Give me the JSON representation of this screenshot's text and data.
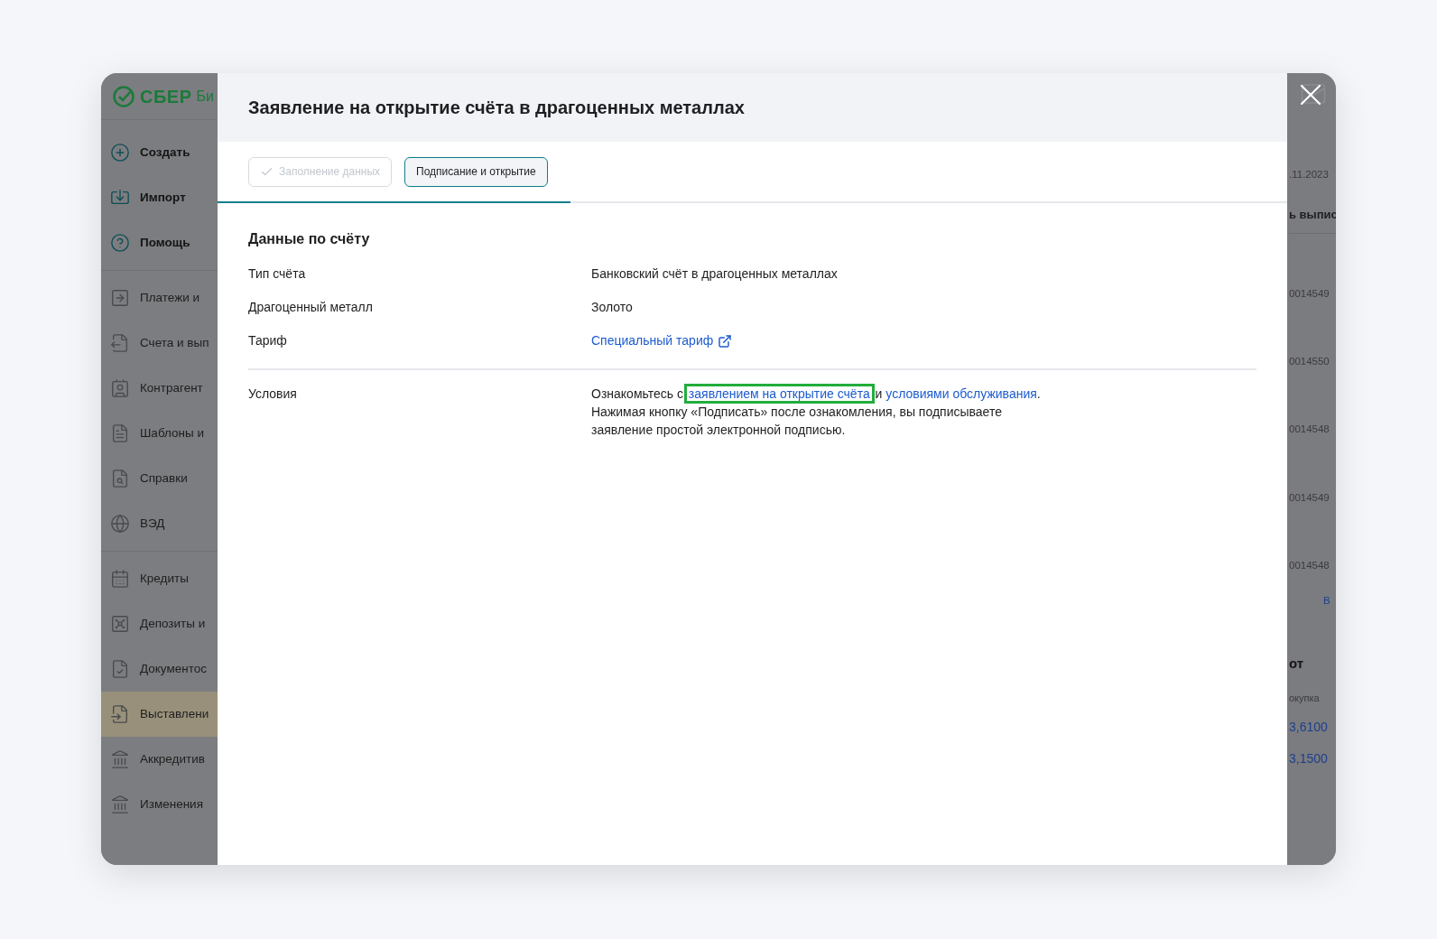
{
  "logo": {
    "brand": "СБЕР",
    "suffix": "Би"
  },
  "sidebar": {
    "groups": [
      {
        "kind": "actions",
        "items": [
          {
            "label": "Создать",
            "selected": false
          },
          {
            "label": "Импорт",
            "selected": false
          },
          {
            "label": "Помощь",
            "selected": false
          }
        ]
      },
      {
        "kind": "sections",
        "items": [
          {
            "label": "Платежи и",
            "selected": false
          },
          {
            "label": "Счета и вып",
            "selected": false
          },
          {
            "label": "Контрагент",
            "selected": false
          },
          {
            "label": "Шаблоны и",
            "selected": false
          },
          {
            "label": "Справки",
            "selected": false
          },
          {
            "label": "ВЭД",
            "selected": false
          }
        ]
      },
      {
        "kind": "sections",
        "items": [
          {
            "label": "Кредиты",
            "selected": false
          },
          {
            "label": "Депозиты и",
            "selected": false
          },
          {
            "label": "Документос",
            "selected": false
          },
          {
            "label": "Выставлени",
            "selected": true
          },
          {
            "label": "Аккредитив",
            "selected": false
          },
          {
            "label": "Изменения",
            "selected": false
          }
        ]
      }
    ]
  },
  "modal": {
    "title": "Заявление на открытие счёта в драгоценных металлах",
    "steps": [
      {
        "label": "Заполнение данных",
        "done": true,
        "selected": false
      },
      {
        "label": "Подписание и открытие",
        "done": false,
        "selected": true
      }
    ],
    "progress": {
      "level": 0.33
    },
    "section_title": "Данные по счёту",
    "fields": [
      {
        "label": "Тип счёта",
        "kind": "text",
        "value": "Банковский счёт в драгоценных металлах"
      },
      {
        "label": "Драгоценный металл",
        "kind": "text",
        "value": "Золото"
      },
      {
        "label": "Тариф",
        "kind": "link",
        "value": "Специальный тариф"
      }
    ],
    "conditions": {
      "label": "Условия",
      "before": "Ознакомьтесь с",
      "link_1": {
        "text": "заявлением на открытие счёта",
        "highlighted": true
      },
      "middle": "и",
      "link_2": {
        "text": "условиями обслуживания",
        "highlighted": false
      },
      "after": ".",
      "note": "Нажимая кнопку «Подписать» после ознакомления, вы подписываете заявление простой электронной подписью."
    }
  },
  "background_strip": {
    "date": ".11.2023",
    "column": "ь выпис",
    "numbers": [
      "0014549",
      "0014550",
      "0014548",
      "0014549",
      "0014548"
    ],
    "link": "В",
    "heading": "от",
    "subheading": "окупка",
    "rates": [
      "3,6100",
      "3,1500"
    ]
  }
}
